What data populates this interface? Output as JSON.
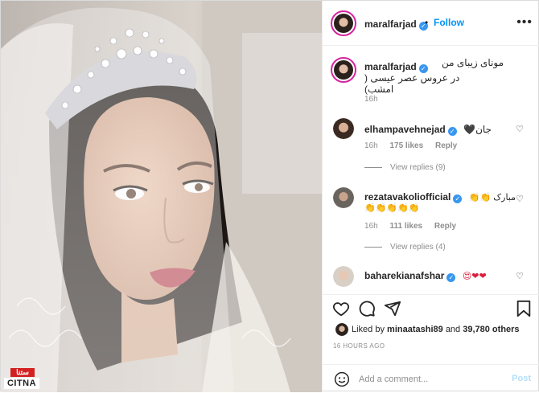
{
  "header": {
    "username": "maralfarjad",
    "separator": "•",
    "follow_label": "Follow",
    "more_icon": "ellipsis-icon"
  },
  "caption": {
    "username": "maralfarjad",
    "line1": "مونای زیبای من",
    "line2": "در عروس عصر عیسی ( امشب)",
    "time": "16h"
  },
  "comments": [
    {
      "username": "elhampavehnejad",
      "text": "جان🖤",
      "time": "16h",
      "likes": "175 likes",
      "reply_label": "Reply",
      "view_replies": "View replies (9)"
    },
    {
      "username": "rezatavakoliofficial",
      "text": "مبارک 👏👏",
      "text2": "👏👏👏👏👏",
      "time": "16h",
      "likes": "111 likes",
      "reply_label": "Reply",
      "view_replies": "View replies (4)"
    },
    {
      "username": "baharekianafshar",
      "text": "😍❤❤"
    }
  ],
  "likes": {
    "prefix": "Liked by",
    "user": "minaatashi89",
    "middle": "and",
    "count": "39,780 others"
  },
  "timestamp": "16 HOURS AGO",
  "add_comment": {
    "placeholder": "Add a comment...",
    "post_label": "Post"
  },
  "watermark": {
    "badge": "ستنا",
    "text": "CITNA"
  },
  "colors": {
    "accent": "#0095f6",
    "verified": "#3897f0",
    "muted": "#8e8e8e",
    "post_disabled": "#b2dffc",
    "border": "#dbdbdb"
  }
}
